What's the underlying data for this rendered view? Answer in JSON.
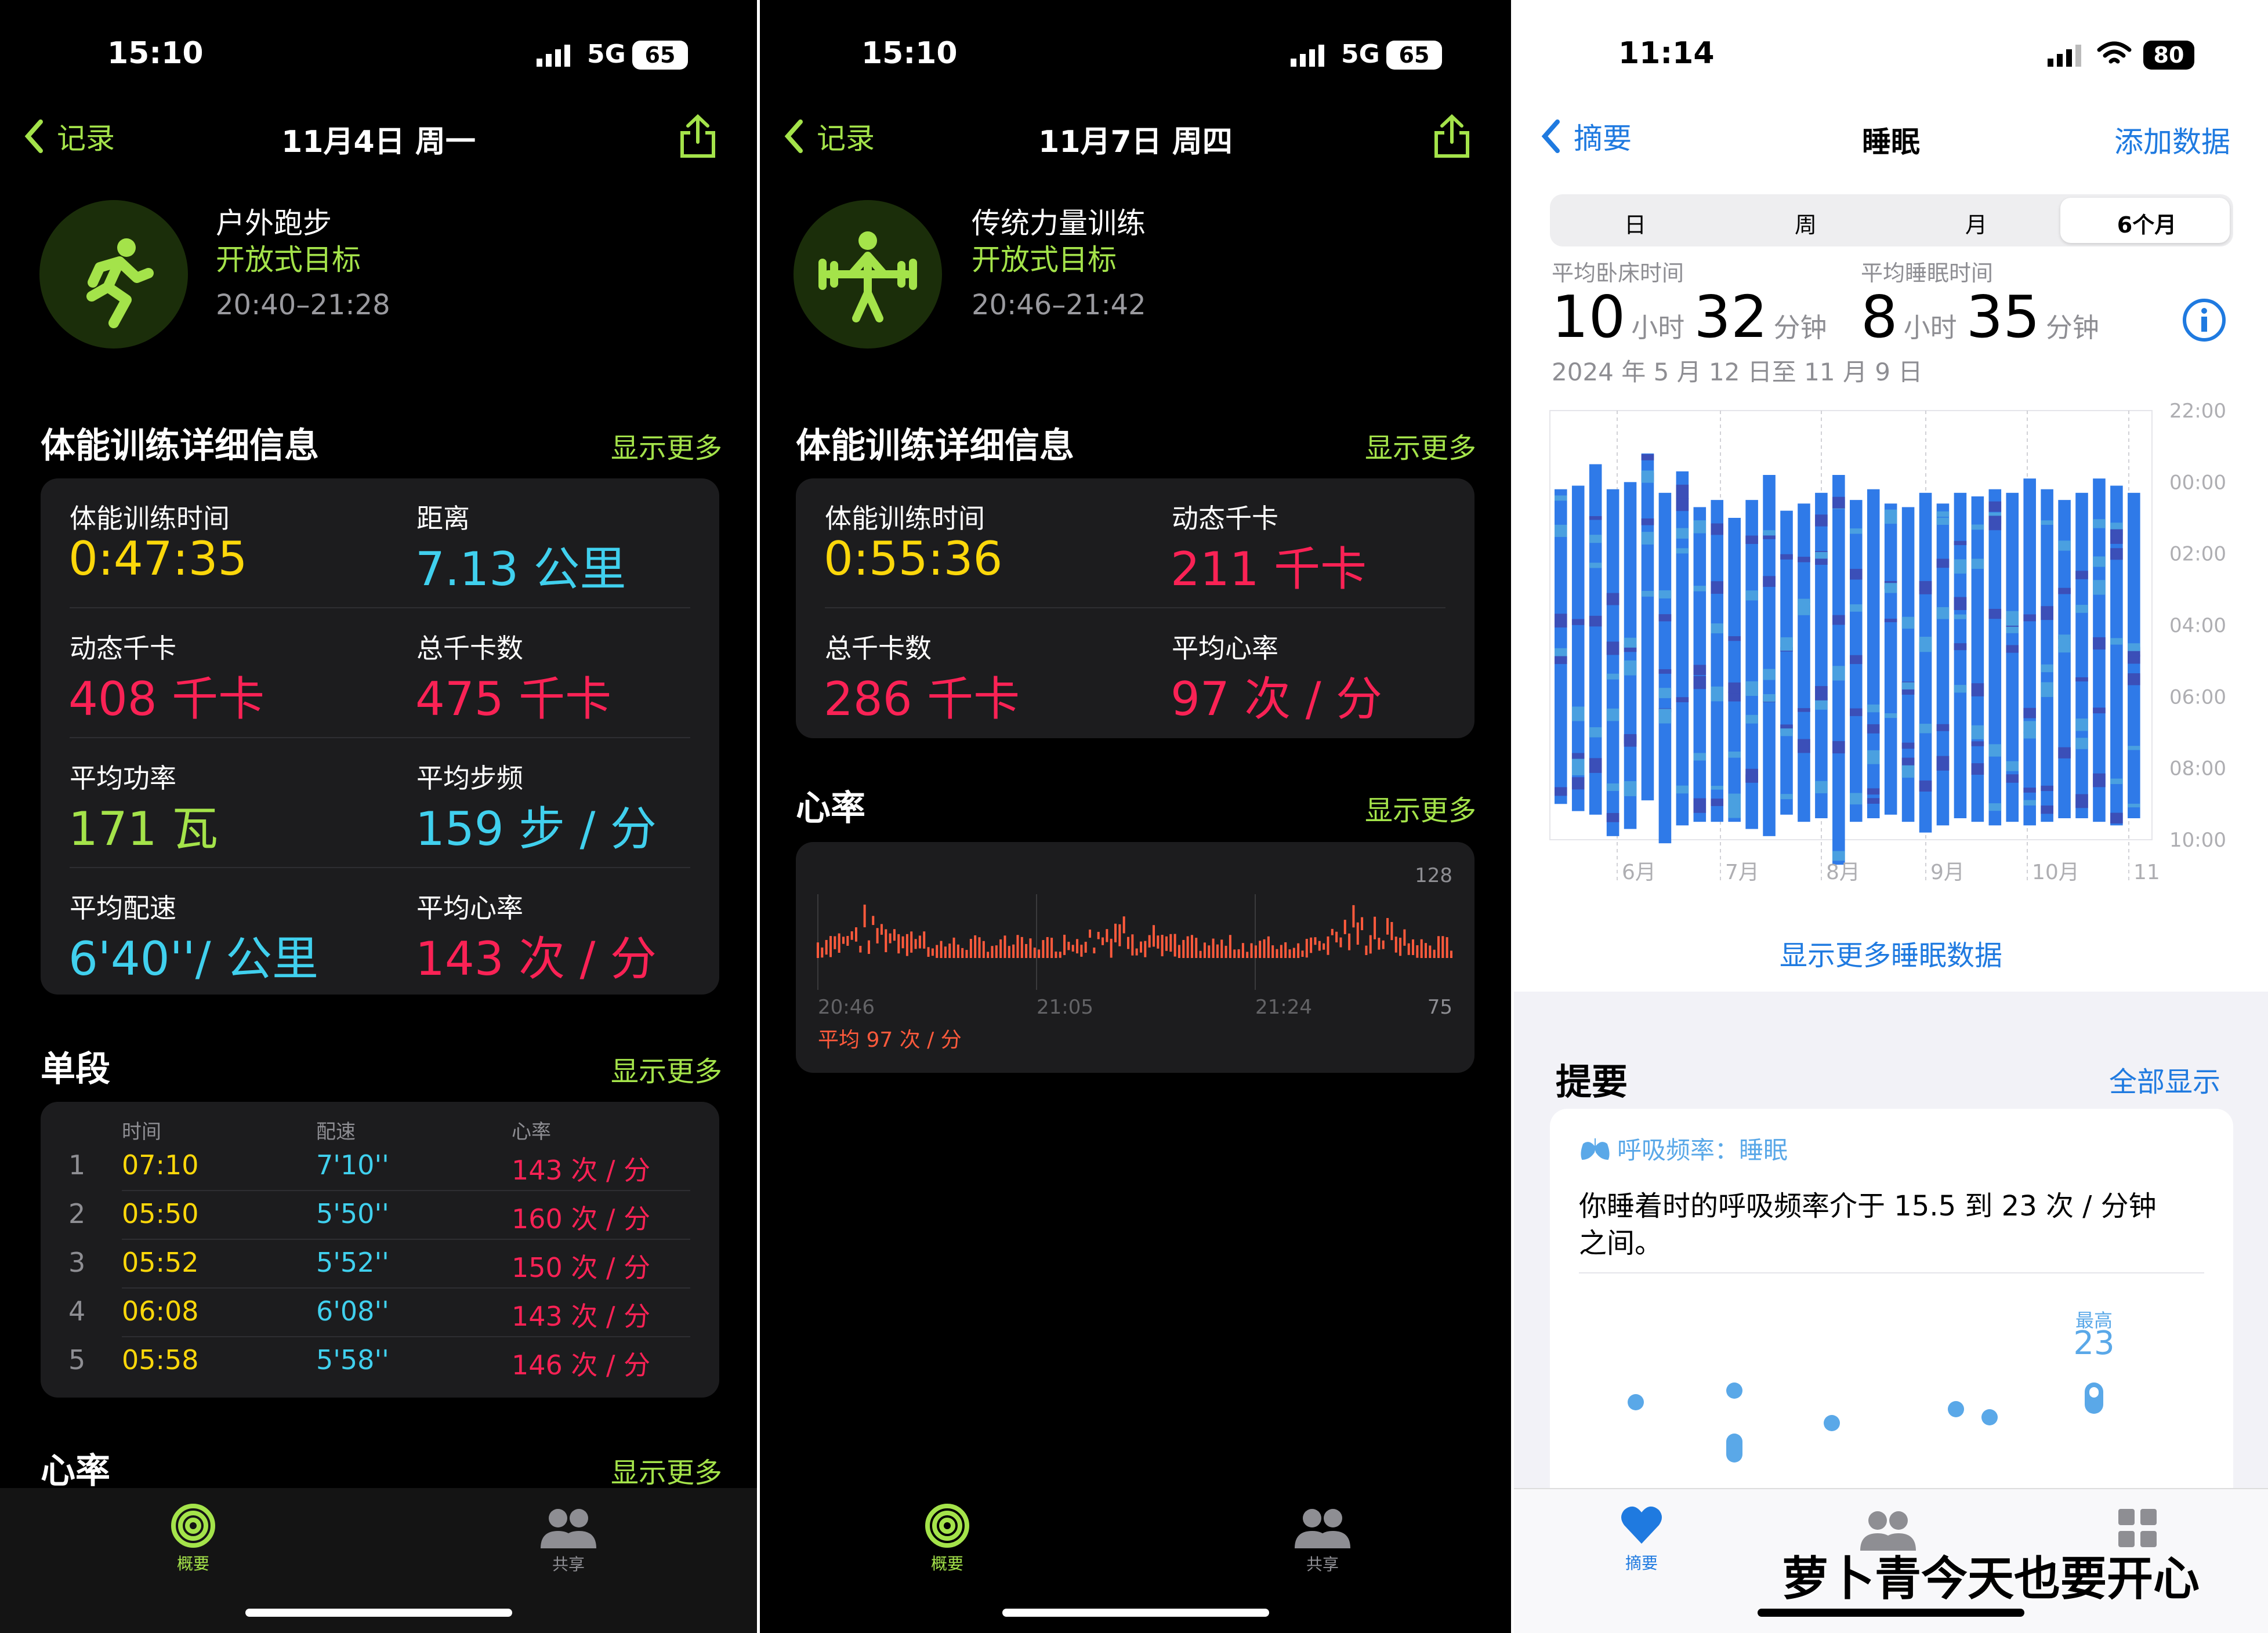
{
  "colors": {
    "yellow": "#fcd70a",
    "cyan": "#40d0ee",
    "red": "#fa2255",
    "green": "#a4e34a",
    "orange": "#ff5a3c",
    "blue": "#1f7ae0",
    "teal": "#5ae0d0"
  },
  "p1": {
    "status": {
      "time": "15:10",
      "net": "5G",
      "batt": "65"
    },
    "nav": {
      "back": "记录",
      "title": "11月4日 周一"
    },
    "workout": {
      "name": "户外跑步",
      "goal": "开放式目标",
      "time": "20:40–21:28",
      "icon": "runner-icon"
    },
    "details": {
      "title": "体能训练详细信息",
      "more": "显示更多",
      "metrics": [
        {
          "label": "体能训练时间",
          "value": "0:47:35"
        },
        {
          "label": "距离",
          "value": "7.13 公里"
        },
        {
          "label": "动态千卡",
          "value": "408 千卡"
        },
        {
          "label": "总千卡数",
          "value": "475 千卡"
        },
        {
          "label": "平均功率",
          "value": "171 瓦"
        },
        {
          "label": "平均步频",
          "value": "159 步 / 分"
        },
        {
          "label": "平均配速",
          "value": "6'40''/ 公里"
        },
        {
          "label": "平均心率",
          "value": "143 次 / 分"
        }
      ]
    },
    "splits": {
      "title": "单段",
      "more": "显示更多",
      "headers": [
        "时间",
        "配速",
        "心率"
      ],
      "rows": [
        {
          "n": "1",
          "time": "07:10",
          "pace": "7'10''",
          "hr": "143 次 / 分"
        },
        {
          "n": "2",
          "time": "05:50",
          "pace": "5'50''",
          "hr": "160 次 / 分"
        },
        {
          "n": "3",
          "time": "05:52",
          "pace": "5'52''",
          "hr": "150 次 / 分"
        },
        {
          "n": "4",
          "time": "06:08",
          "pace": "6'08''",
          "hr": "143 次 / 分"
        },
        {
          "n": "5",
          "time": "05:58",
          "pace": "5'58''",
          "hr": "146 次 / 分"
        }
      ]
    },
    "hr": {
      "title": "心率",
      "more": "显示更多"
    },
    "tabs": {
      "summary": "概要",
      "share": "共享"
    }
  },
  "p2": {
    "status": {
      "time": "15:10",
      "net": "5G",
      "batt": "65"
    },
    "nav": {
      "back": "记录",
      "title": "11月7日 周四"
    },
    "workout": {
      "name": "传统力量训练",
      "goal": "开放式目标",
      "time": "20:46–21:42",
      "icon": "weightlifter-icon"
    },
    "details": {
      "title": "体能训练详细信息",
      "more": "显示更多",
      "metrics": [
        {
          "label": "体能训练时间",
          "value": "0:55:36"
        },
        {
          "label": "动态千卡",
          "value": "211 千卡"
        },
        {
          "label": "总千卡数",
          "value": "286 千卡"
        },
        {
          "label": "平均心率",
          "value": "97 次 / 分"
        }
      ]
    },
    "hr": {
      "title": "心率",
      "more": "显示更多",
      "max": "128",
      "min": "75",
      "x_labels": [
        "20:46",
        "21:05",
        "21:24"
      ],
      "avg": "平均 97 次 / 分"
    },
    "tabs": {
      "summary": "概要",
      "share": "共享"
    }
  },
  "p3": {
    "status": {
      "time": "11:14",
      "batt": "80"
    },
    "nav": {
      "back": "摘要",
      "title": "睡眠",
      "action": "添加数据"
    },
    "segments": [
      "日",
      "周",
      "月",
      "6个月"
    ],
    "selected_segment": "6个月",
    "inbed": {
      "label": "平均卧床时间",
      "h": "10",
      "hu": "小时",
      "m": "32",
      "mu": "分钟"
    },
    "asleep": {
      "label": "平均睡眠时间",
      "h": "8",
      "hu": "小时",
      "m": "35",
      "mu": "分钟"
    },
    "range": "2024 年 5 月 12 日至 11 月 9 日",
    "more_link": "显示更多睡眠数据",
    "highlights": {
      "title": "提要",
      "all": "全部显示",
      "card_title": "呼吸频率：睡眠",
      "card_text1": "你睡着时的呼吸频率介于 15.5 到 23 次 / 分钟",
      "card_text2": "之间。",
      "max_label": "最高",
      "max_val": "23"
    },
    "tabs": {
      "summary": "摘要"
    },
    "watermark": "萝卜青今天也要开心"
  },
  "chart_data": [
    {
      "type": "bar",
      "subtype": "range",
      "title": "睡眠",
      "y_ticks": [
        "22:00",
        "00:00",
        "02:00",
        "04:00",
        "06:00",
        "08:00",
        "10:00"
      ],
      "x_ticks": [
        "6月",
        "7月",
        "8月",
        "9月",
        "10月",
        "11"
      ],
      "series": [
        {
          "values": [
            [
              0.2,
              9.0
            ],
            [
              0.1,
              9.2
            ],
            [
              -0.5,
              9.3
            ],
            [
              0.2,
              9.9
            ],
            [
              0,
              9.7
            ],
            [
              -0.8,
              8.9
            ],
            [
              0.3,
              10.1
            ],
            [
              -0.3,
              9.6
            ],
            [
              0.7,
              9.5
            ],
            [
              0.5,
              9.5
            ],
            [
              1,
              9.5
            ],
            [
              0.5,
              9.7
            ],
            [
              -0.2,
              9.9
            ],
            [
              0.8,
              9.3
            ],
            [
              0.6,
              9.5
            ],
            [
              0.3,
              9.4
            ],
            [
              -0.2,
              10.7
            ],
            [
              0.5,
              9.5
            ],
            [
              0.2,
              9.4
            ],
            [
              0.6,
              9.3
            ],
            [
              0.7,
              9.5
            ],
            [
              0.3,
              9.8
            ],
            [
              0.6,
              9.6
            ],
            [
              0.3,
              9.4
            ],
            [
              0.4,
              9.5
            ],
            [
              0.2,
              9.6
            ],
            [
              0.3,
              9.5
            ],
            [
              -0.1,
              9.6
            ],
            [
              0.2,
              9.5
            ],
            [
              0.5,
              9.4
            ],
            [
              0.3,
              9.4
            ],
            [
              -0.1,
              9.5
            ],
            [
              0.1,
              9.6
            ],
            [
              0.3,
              9.4
            ]
          ]
        }
      ]
    },
    {
      "type": "line",
      "title": "心率",
      "y_range": [
        75,
        128
      ],
      "x_ticks": [
        "20:46",
        "21:05",
        "21:24"
      ]
    },
    {
      "type": "scatter",
      "title": "呼吸频率：睡眠",
      "max": 23
    }
  ]
}
